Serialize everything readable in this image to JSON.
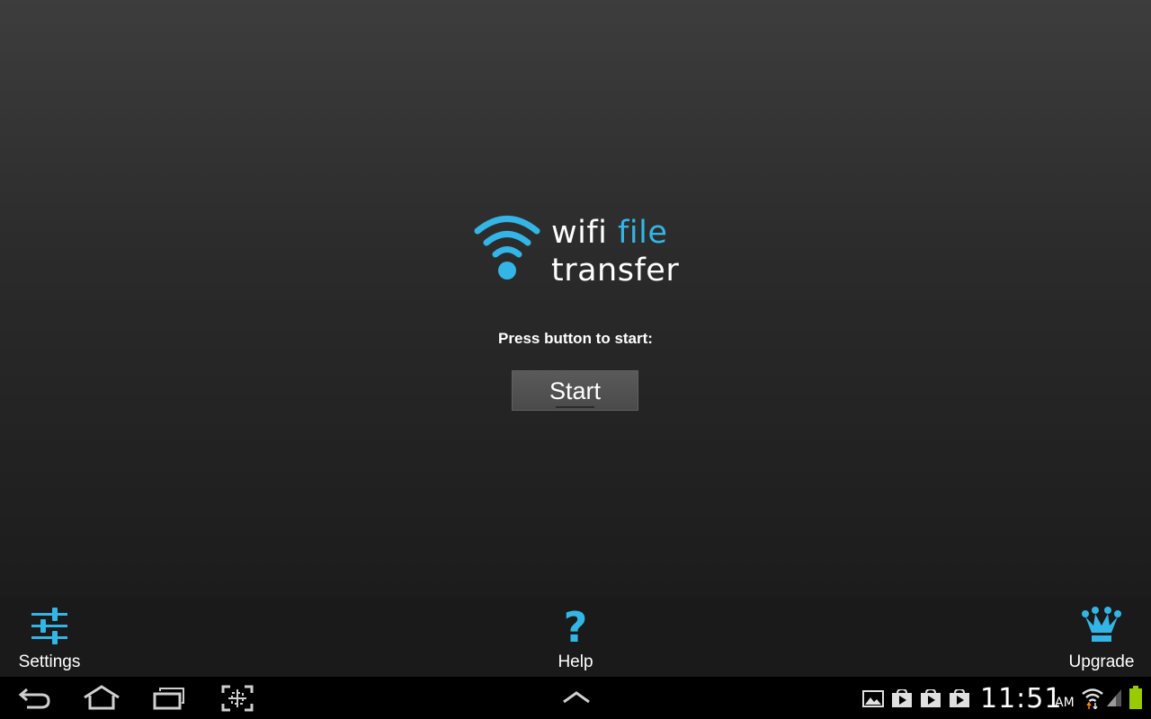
{
  "app": {
    "logo_word1": "wifi",
    "logo_word2": "file",
    "logo_word3": "transfer",
    "accent_color": "#33b5e5",
    "prompt": "Press button to start:",
    "start_label": "Start"
  },
  "action_bar": {
    "settings_label": "Settings",
    "help_label": "Help",
    "help_glyph": "?",
    "upgrade_label": "Upgrade",
    "icons": [
      "sliders-icon",
      "question-icon",
      "crown-icon"
    ]
  },
  "system_bar": {
    "time": "11:51",
    "ampm": "AM",
    "nav_icons": [
      "back-icon",
      "home-icon",
      "recent-apps-icon",
      "screenshot-icon",
      "menu-up-icon"
    ],
    "status_icons": [
      "gallery-notification-icon",
      "play-store-notification-icon",
      "play-store-notification-icon",
      "play-store-notification-icon",
      "wifi-icon",
      "signal-icon",
      "battery-icon"
    ],
    "battery_color": "#99cc00"
  }
}
